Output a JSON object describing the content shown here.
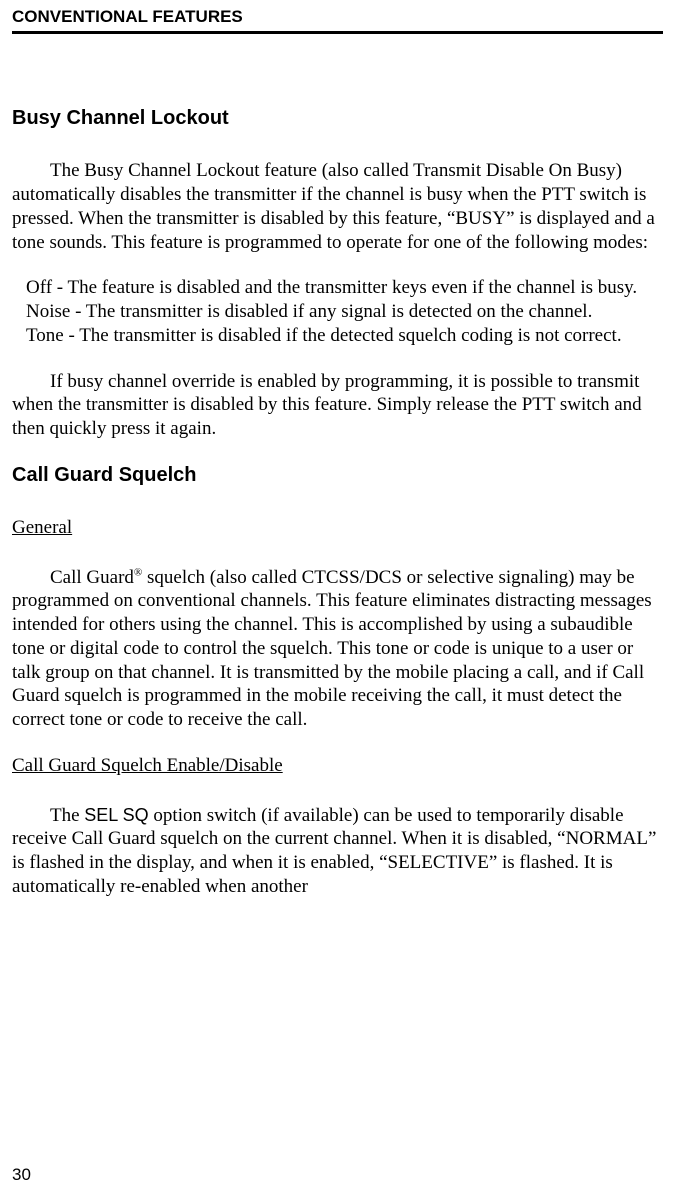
{
  "header": "CONVENTIONAL FEATURES",
  "page_number": "30",
  "section1": {
    "title": "Busy Channel Lockout",
    "p1": "The Busy Channel Lockout feature (also called Transmit Disable On Busy) automatically disables the transmitter if the channel is busy when the PTT switch is pressed. When the transmitter is disabled by this feature, “BUSY” is displayed and a tone sounds. This feature is programmed to operate for one of the following modes:",
    "modes": [
      "Off - The feature is disabled and the transmitter keys even if the channel is busy.",
      "Noise - The transmitter is disabled if any signal is detected on the channel.",
      "Tone - The transmitter is disabled if the detected squelch coding is not correct."
    ],
    "p2": "If busy channel override is enabled by programming, it is possible to transmit when the transmitter is disabled by this feature. Simply release the PTT switch and then quickly press it again."
  },
  "section2": {
    "title": "Call Guard Squelch",
    "sub1": {
      "title": "General",
      "p1a": "Call Guard",
      "reg": "®",
      "p1b": " squelch (also called CTCSS/DCS or selective signaling) may be programmed on conventional channels. This feature eliminates distracting messages intended for others using the channel. This is accomplished by using a subaudible tone or digital code to control the squelch. This tone or code is unique to a user or talk group on that channel. It is transmitted by the mobile placing a call, and if Call Guard squelch is programmed in the mobile receiving the call, it must detect the correct tone or code to receive the call."
    },
    "sub2": {
      "title": "Call Guard Squelch Enable/Disable",
      "p1a": "The ",
      "selsq": "SEL SQ",
      "p1b": " option switch (if available) can be used to temporarily disable receive Call Guard squelch on the current channel. When it is disabled, “NORMAL” is flashed in the display, and when it is enabled, “SELECTIVE” is flashed. It is automatically re-enabled when another"
    }
  }
}
